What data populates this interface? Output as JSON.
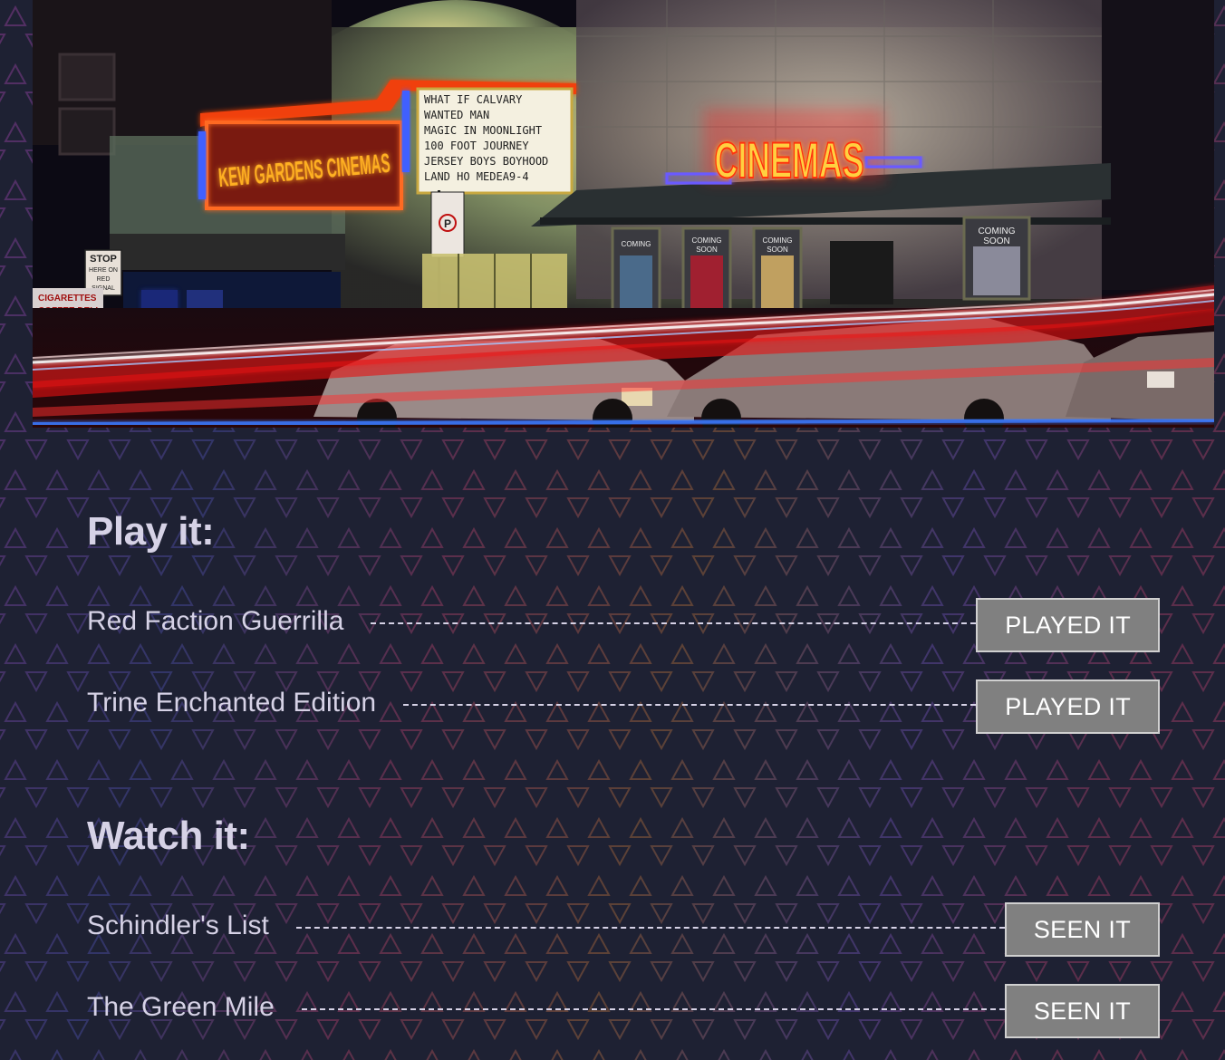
{
  "hero": {
    "theater_sign": "KEW GARDENS CINEMAS",
    "marquee_lines": [
      "WHAT IF     CALVARY",
      "WANTED MAN",
      "MAGIC IN MOONLIGHT",
      "100 FOOT JOURNEY",
      "JERSEY BOYS  BOYHOOD",
      "LAND HO     MEDEA9-4"
    ],
    "neon_sign": "CINEMAS",
    "stop_sign": [
      "STOP",
      "HERE ON",
      "RED",
      "SIGNAL"
    ],
    "deli_sign": [
      "CIGARETTES",
      "COFFEE DELI"
    ],
    "poster_label": [
      "COMING",
      "SOON"
    ]
  },
  "play_section": {
    "title": "Play it:",
    "items": [
      {
        "label": "Red Faction Guerrilla",
        "button": "PLAYED IT"
      },
      {
        "label": "Trine Enchanted Edition",
        "button": "PLAYED IT"
      }
    ]
  },
  "watch_section": {
    "title": "Watch it:",
    "items": [
      {
        "label": "Schindler's List",
        "button": "SEEN IT"
      },
      {
        "label": "The Green Mile",
        "button": "SEEN IT"
      }
    ]
  },
  "colors": {
    "background": "#1e2133",
    "text": "#d6d2e6",
    "button_bg": "#808080",
    "button_border": "#d0d0d0"
  }
}
